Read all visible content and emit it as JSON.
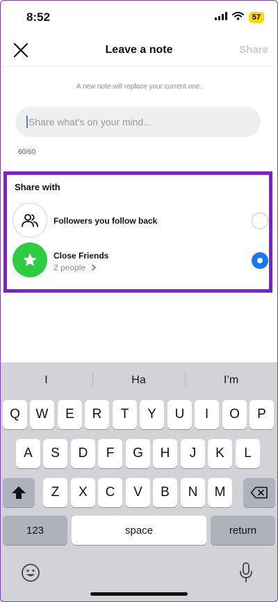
{
  "status_bar": {
    "time": "8:52",
    "battery": "57"
  },
  "header": {
    "title": "Leave a note",
    "share_label": "Share"
  },
  "hint": "A new note will replace your current one.",
  "note_input": {
    "placeholder": "Share what's on your mind...",
    "counter": "60/60"
  },
  "share_with": {
    "title": "Share with",
    "options": [
      {
        "label": "Followers you follow back",
        "selected": false
      },
      {
        "label": "Close Friends",
        "sub": "2 people",
        "selected": true
      }
    ]
  },
  "keyboard": {
    "suggestions": [
      "I",
      "Ha",
      "I’m"
    ],
    "row1": [
      "Q",
      "W",
      "E",
      "R",
      "T",
      "Y",
      "U",
      "I",
      "O",
      "P"
    ],
    "row2": [
      "A",
      "S",
      "D",
      "F",
      "G",
      "H",
      "J",
      "K",
      "L"
    ],
    "row3": [
      "Z",
      "X",
      "C",
      "V",
      "B",
      "N",
      "M"
    ],
    "numbers_label": "123",
    "space_label": "space",
    "return_label": "return"
  },
  "icons": [
    "close-icon",
    "signal-icon",
    "wifi-icon",
    "people-icon",
    "star-icon",
    "chevron-right-icon",
    "shift-icon",
    "backspace-icon",
    "emoji-icon",
    "mic-icon"
  ]
}
